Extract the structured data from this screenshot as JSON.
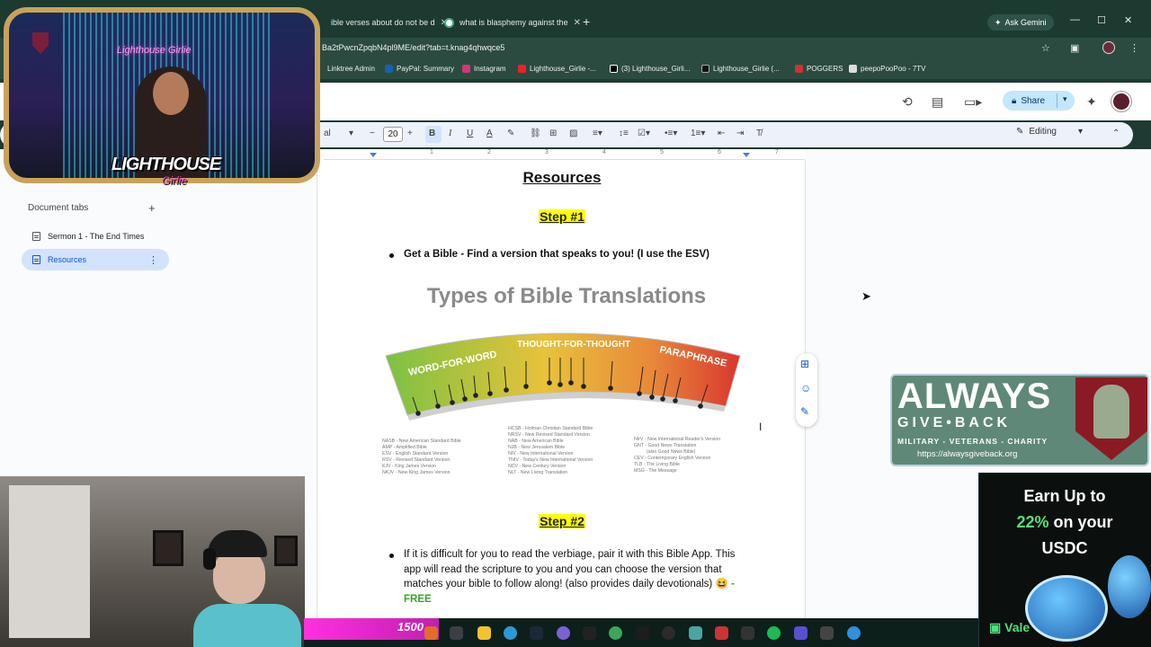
{
  "browser": {
    "tabs": [
      {
        "title": "ible verses about do not be d"
      },
      {
        "title": "what is blasphemy against the"
      }
    ],
    "ask_gemini": "Ask Gemini",
    "url": "Ba2tPwcnZpqbN4pl9ME/edit?tab=t.knag4qhwqce5",
    "bookmarks": [
      "Linktree Admin",
      "PayPal: Summary",
      "Instagram",
      "Lighthouse_Girlie -...",
      "(3) Lighthouse_Girli...",
      "Lighthouse_Girlie (...",
      "POGGERS",
      "peepoPooPoo - 7TV"
    ]
  },
  "docs": {
    "share_label": "Share",
    "font_size": "20",
    "font_name": "al",
    "mode": "Editing",
    "tabs_heading": "Document tabs",
    "doc_tabs": [
      {
        "label": "Sermon 1 - The End Times",
        "active": false
      },
      {
        "label": "Resources",
        "active": true
      }
    ],
    "ruler_numbers": [
      "1",
      "2",
      "3",
      "4",
      "5",
      "6",
      "7"
    ]
  },
  "document": {
    "title": "Resources",
    "step1": "Step #1",
    "bullet1": "Get a Bible - Find a version that speaks to you! (I use the ESV)",
    "image": {
      "title": "Types of Bible Translations",
      "arc_left": "WORD-FOR-WORD",
      "arc_mid": "THOUGHT-FOR-THOUGHT",
      "arc_right": "PARAPHRASE",
      "legend_col1": [
        "NASB - New American Standard Bible",
        "AMP - Amplified Bible",
        "ESV - English Standard Version",
        "RSV - Revised Standard Version",
        "KJV - King James Version",
        "NKJV - New King James Version"
      ],
      "legend_col2": [
        "HCSB - Holman Christian Standard Bible",
        "NRSV - New Revised Standard Version",
        "NAB - New American Bible",
        "NJB - New Jerusalem Bible",
        "NIV - New International Version",
        "TNIV - Today's New International Version",
        "NCV - New Century Version",
        "NLT - New Living Translation"
      ],
      "legend_col3": [
        "NIrV - New International Reader's Version",
        "GNT - Good News Translation",
        "(also Good News Bible)",
        "CEV - Contemporary English Version",
        "TLB - The Living Bible",
        "MSG - The Message"
      ]
    },
    "step2": "Step #2",
    "bullet2": "If it is difficult for you to read the verbiage, pair it with this Bible App. This app will read the scripture to you and you can choose the version that matches your bible to follow along! (also provides daily devotionals) 😆",
    "bullet2_free": "- FREE"
  },
  "overlays": {
    "neon_sign": "Lighthouse Girlie",
    "logo_main": "LIGHTHOUSE",
    "logo_sub": "Girlie",
    "agb_always": "ALWAYS",
    "agb_give": "GIVE•BACK",
    "agb_mil": "MILITARY - VETERANS - CHARITY",
    "agb_url": "https://alwaysgiveback.org",
    "usdc_line1": "Earn Up to",
    "usdc_pct": "22%",
    "usdc_line2": " on your",
    "usdc_line3": "USDC",
    "vale": "Vale",
    "bits": "1500"
  }
}
